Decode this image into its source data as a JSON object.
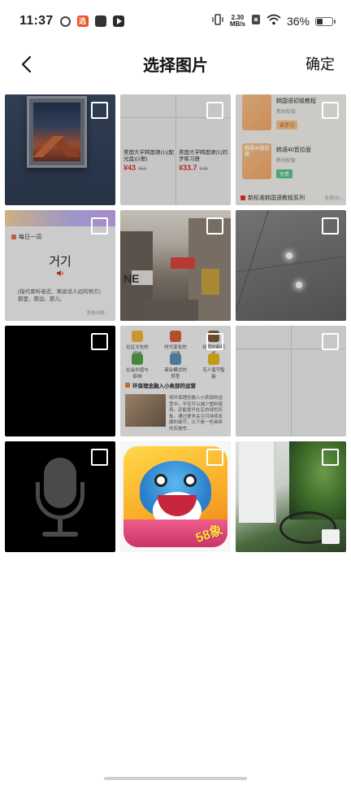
{
  "status_bar": {
    "time": "11:37",
    "app_badge": "选",
    "net_speed_value": "2.30",
    "net_speed_unit": "MB/s",
    "battery_percent": "36%",
    "battery_level": 0.36
  },
  "header": {
    "title": "选择图片",
    "confirm_label": "确定"
  },
  "tiles": {
    "t2": {
      "product1_name": "美国大学韩国语(1)(配光盘)(2册)",
      "product1_price": "¥43",
      "product1_old": "¥58",
      "product2_name": "美国大学韩国语(1)同步练习册",
      "product2_price": "¥33.7",
      "product2_old": "¥45"
    },
    "t3": {
      "card1_title": "韩国语初级教程",
      "card1_sub": "教材配套",
      "card1_tag": "去学习",
      "card2_thumb": "韩语40音拉面",
      "card2_title": "韩语40音拉面",
      "card2_sub": "教材配套",
      "card2_tag": "免费",
      "series_label": "新标准韩国语教程系列",
      "series_all": "全部(8) ›"
    },
    "t4": {
      "head": "每日一词",
      "word": "거기",
      "definition": "(指代离听者近、离说话人远的地方)那里、那边、那儿;",
      "more": "查看详解 ›"
    },
    "t5": {
      "sign_text": "NE"
    },
    "t8": {
      "row1": [
        "社区文化的烦恼",
        "时代变化的规律",
        "经营的新模式"
      ],
      "row2": [
        "社会价值与影响",
        "商业模式的转型",
        "无人值守智能"
      ],
      "section_title": "环保理念融入小卖部的运营",
      "paragraph": "将环保理念融入小卖部的运营中，不仅可以减少塑料使用，还能提升社区的绿色形象。通过更多关注可持续发展的细节，以下是一些具体的实施举..."
    },
    "t11": {
      "game_label": "58象"
    }
  },
  "colors": {
    "price_red": "#e0302b",
    "checkbox_border": "#ffffff",
    "title_text": "#111111"
  },
  "icons": {
    "back": "chevron-left-icon",
    "wifi": "wifi-icon",
    "vibrate": "vibrate-icon",
    "mic": "microphone-icon"
  }
}
